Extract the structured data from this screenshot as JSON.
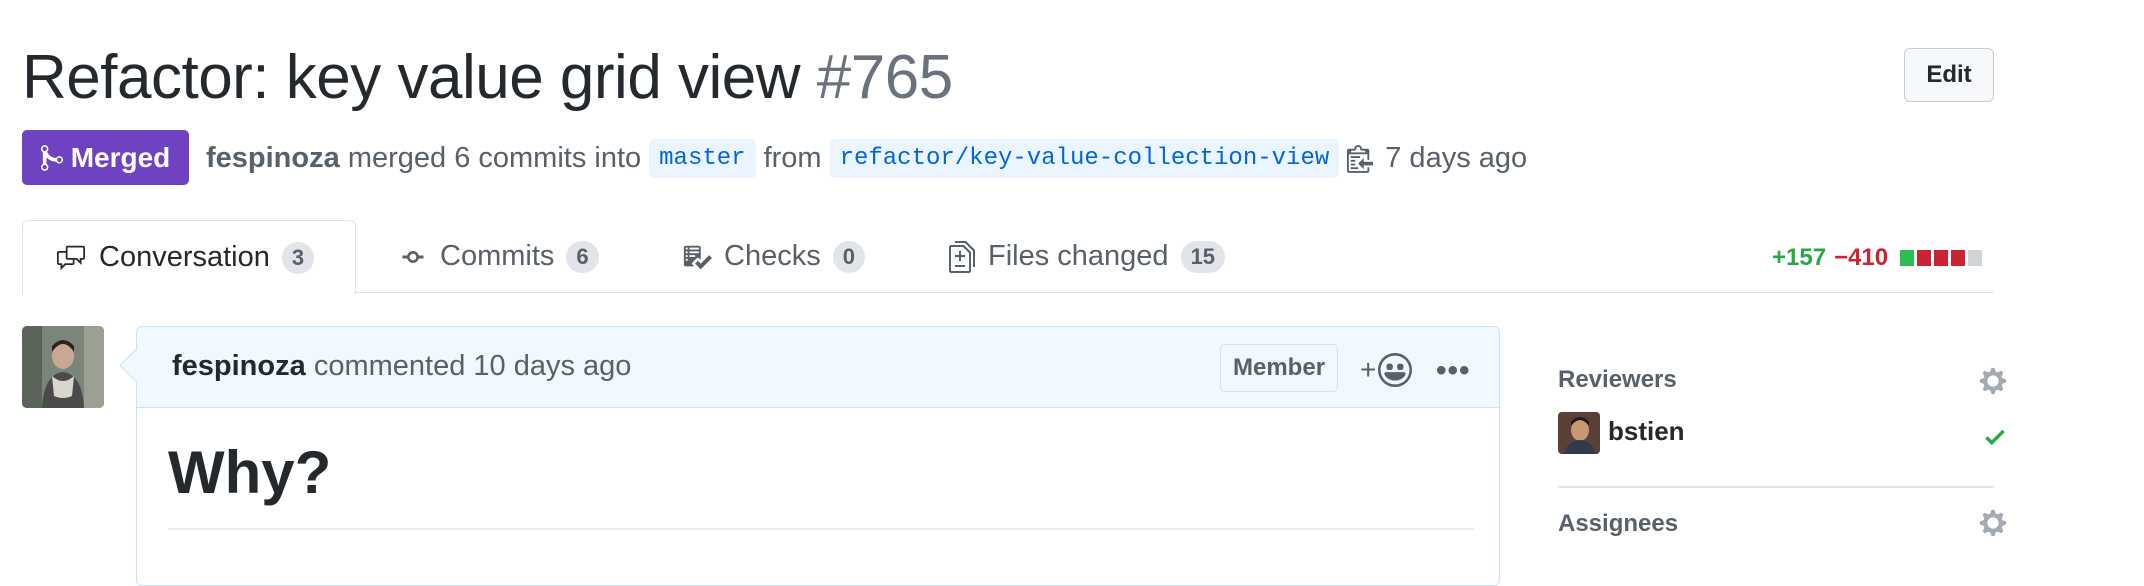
{
  "pr": {
    "title": "Refactor: key value grid view",
    "number": "#765",
    "edit_label": "Edit",
    "state_label": "Merged",
    "author": "fespinoza",
    "merged_text": "merged 6 commits into",
    "base_branch": "master",
    "from_text": "from",
    "head_branch": "refactor/key-value-collection-view",
    "time_ago": "7 days ago"
  },
  "tabs": [
    {
      "label": "Conversation",
      "count": "3",
      "icon": "comment-discussion-icon"
    },
    {
      "label": "Commits",
      "count": "6",
      "icon": "git-commit-icon"
    },
    {
      "label": "Checks",
      "count": "0",
      "icon": "checklist-icon"
    },
    {
      "label": "Files changed",
      "count": "15",
      "icon": "file-diff-icon"
    }
  ],
  "diffstat": {
    "additions": "+157",
    "deletions": "−410"
  },
  "comment": {
    "author": "fespinoza",
    "action": "commented",
    "time": "10 days ago",
    "role_badge": "Member",
    "reaction_label": "+",
    "more_label": "•••",
    "body_heading": "Why?"
  },
  "sidebar": {
    "reviewers_heading": "Reviewers",
    "reviewers": [
      {
        "name": "bstien",
        "status": "approved"
      }
    ],
    "assignees_heading": "Assignees"
  },
  "colors": {
    "merged": "#6f42c1",
    "link": "#0366d6",
    "additions": "#28a745",
    "deletions": "#cb2431",
    "comment_border": "#c8e1ff",
    "comment_header_bg": "#f1f8ff"
  }
}
